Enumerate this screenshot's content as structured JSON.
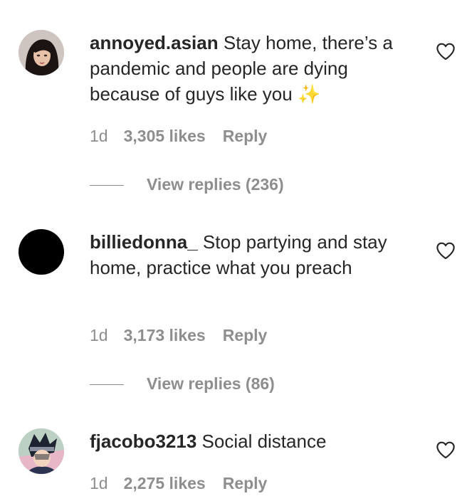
{
  "comments": [
    {
      "username": "annoyed.asian",
      "text": "Stay home, there’s a pandemic and people are dying because of guys like you",
      "emoji": "✨",
      "time": "1d",
      "likes": "3,305 likes",
      "reply_label": "Reply",
      "view_replies": "View replies (236)"
    },
    {
      "username": "billiedonna_",
      "text": "Stop partying and stay home, practice what you preach",
      "emoji": "",
      "time": "1d",
      "likes": "3,173 likes",
      "reply_label": "Reply",
      "view_replies": "View replies (86)"
    },
    {
      "username": "fjacobo3213",
      "text": "Social distance",
      "emoji": "",
      "time": "1d",
      "likes": "2,275 likes",
      "reply_label": "Reply",
      "view_replies": ""
    }
  ],
  "icons": {
    "like": "heart-outline-icon"
  },
  "colors": {
    "text": "#262626",
    "secondary": "#8e8e8e",
    "background": "#ffffff"
  }
}
